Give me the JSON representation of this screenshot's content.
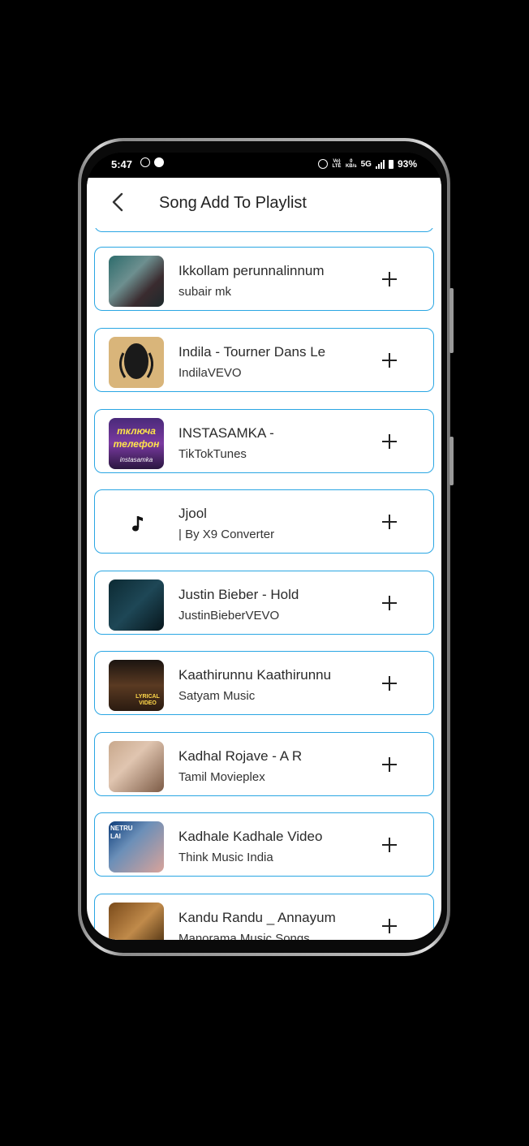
{
  "status_bar": {
    "time": "5:47",
    "battery": "93%",
    "network": "5G",
    "volte": "Vo) LTE",
    "speed_value": "0",
    "speed_unit": "KB/s"
  },
  "app_bar": {
    "title": "Song Add To Playlist",
    "back_icon": "arrow-back-icon"
  },
  "songs": [
    {
      "title": "Ikkollam perunnalinnum",
      "artist": "subair mk",
      "thumb": "photo"
    },
    {
      "title": "Indila - Tourner Dans Le",
      "artist": "IndilaVEVO",
      "thumb": "photo"
    },
    {
      "title": "INSTASAMKA -",
      "artist": "TikTokTunes",
      "thumb": "photo",
      "thumb_text": "тключа телефон",
      "thumb_sub": "instasamka"
    },
    {
      "title": "Jjool",
      "artist": "| By X9 Converter",
      "thumb": "music-note-icon"
    },
    {
      "title": "Justin Bieber - Hold",
      "artist": "JustinBieberVEVO",
      "thumb": "photo"
    },
    {
      "title": "Kaathirunnu Kaathirunnu",
      "artist": "Satyam Music",
      "thumb": "photo",
      "thumb_sub": "LYRICAL VIDEO"
    },
    {
      "title": "Kadhal Rojave - A R",
      "artist": "Tamil Movieplex",
      "thumb": "photo"
    },
    {
      "title": "Kadhale Kadhale Video",
      "artist": "Think Music India",
      "thumb": "photo",
      "thumb_text": "NETRU LAI"
    },
    {
      "title": "Kandu Randu _ Annayum",
      "artist": "Manorama Music Songs",
      "thumb": "photo"
    }
  ],
  "action_icon": "plus-icon",
  "colors": {
    "card_border": "#2aa6e3",
    "background": "#ffffff",
    "text": "#2b2b2b"
  }
}
